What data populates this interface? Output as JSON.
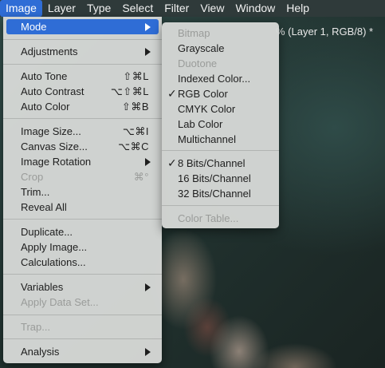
{
  "menubar": {
    "items": [
      "Image",
      "Layer",
      "Type",
      "Select",
      "Filter",
      "View",
      "Window",
      "Help"
    ],
    "active": "Image"
  },
  "document_tab": "% (Layer 1, RGB/8) *",
  "image_menu": {
    "mode": "Mode",
    "adjustments": "Adjustments",
    "auto_tone": {
      "label": "Auto Tone",
      "shortcut": "⇧⌘L"
    },
    "auto_contrast": {
      "label": "Auto Contrast",
      "shortcut": "⌥⇧⌘L"
    },
    "auto_color": {
      "label": "Auto Color",
      "shortcut": "⇧⌘B"
    },
    "image_size": {
      "label": "Image Size...",
      "shortcut": "⌥⌘I"
    },
    "canvas_size": {
      "label": "Canvas Size...",
      "shortcut": "⌥⌘C"
    },
    "image_rotation": "Image Rotation",
    "crop": {
      "label": "Crop",
      "shortcut": "⌘°"
    },
    "trim": "Trim...",
    "reveal_all": "Reveal All",
    "duplicate": "Duplicate...",
    "apply_image": "Apply Image...",
    "calculations": "Calculations...",
    "variables": "Variables",
    "apply_data_set": "Apply Data Set...",
    "trap": "Trap...",
    "analysis": "Analysis"
  },
  "mode_submenu": {
    "bitmap": "Bitmap",
    "grayscale": "Grayscale",
    "duotone": "Duotone",
    "indexed_color": "Indexed Color...",
    "rgb_color": "RGB Color",
    "cmyk_color": "CMYK Color",
    "lab_color": "Lab Color",
    "multichannel": "Multichannel",
    "bits8": "8 Bits/Channel",
    "bits16": "16 Bits/Channel",
    "bits32": "32 Bits/Channel",
    "color_table": "Color Table...",
    "checkmark": "✓"
  },
  "colors": {
    "highlight": "#2f6dd6"
  }
}
